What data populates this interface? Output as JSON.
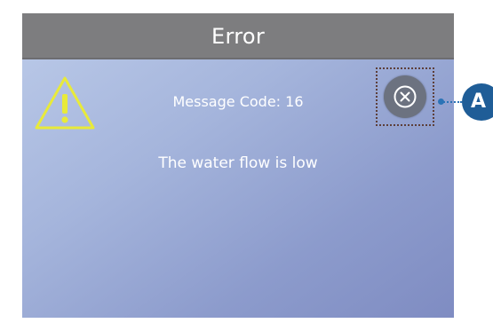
{
  "dialog": {
    "title": "Error",
    "message_code": "Message Code: 16",
    "message": "The water flow is low"
  },
  "icons": {
    "warning": "warning-triangle-icon",
    "close": "close-circle-x-icon"
  },
  "callout": {
    "label": "A"
  },
  "colors": {
    "title_bar": "#7d7d7f",
    "background_top": "#bccbe9",
    "background_bottom": "#7f8cc2",
    "warning_icon": "#e8ea3a",
    "close_button": "#6c7280",
    "callout": "#1f5d97"
  }
}
